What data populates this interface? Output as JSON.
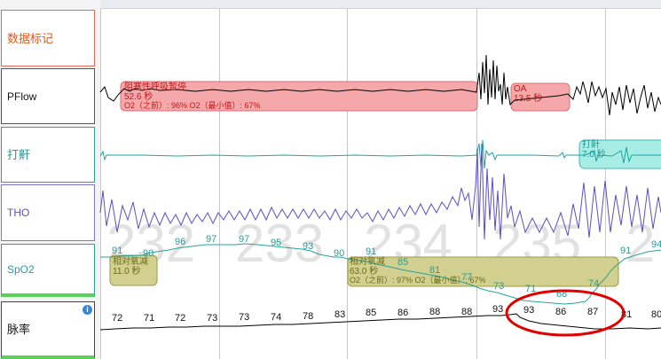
{
  "labels": {
    "marker": "数据标记",
    "pflow": "PFlow",
    "snore": "打鼾",
    "tho": "THO",
    "spo2": "SpO2",
    "pulse": "脉率"
  },
  "epochs": {
    "e1": "232",
    "e2": "233",
    "e3": "234",
    "e4": "235",
    "e5": "2"
  },
  "events": {
    "obstructive_apnea": {
      "title": "阻塞性呼吸暂停",
      "duration": "52.6 秒",
      "details": "O2（之前）: 96%  O2（最小值）: 67%"
    },
    "oa": {
      "title": "OA",
      "duration": "13.5 秒"
    },
    "snore": {
      "title": "打鼾",
      "duration": "7.0 秒"
    },
    "hypopnea1": {
      "title": "相对氧减",
      "duration": "11.0 秒"
    },
    "hypopnea2": {
      "title": "相对氧减",
      "duration": "63.0 秒",
      "details": "O2（之前）: 97%  O2（最小值）: 67%"
    }
  },
  "spo2_values": {
    "v1": "91",
    "v2": "90",
    "v3": "96",
    "v4": "97",
    "v5": "97",
    "v6": "95",
    "v7": "93",
    "v8": "90",
    "v9": "91",
    "v10": "85",
    "v11": "81",
    "v12": "77",
    "v13": "73",
    "v14": "71",
    "v15": "68",
    "v16": "74",
    "v17": "91",
    "v18": "94"
  },
  "pulse_values": {
    "p1": "72",
    "p2": "71",
    "p3": "72",
    "p4": "73",
    "p5": "73",
    "p6": "74",
    "p7": "78",
    "p8": "83",
    "p9": "85",
    "p10": "86",
    "p11": "88",
    "p12": "88",
    "p13": "93",
    "p14": "93",
    "p15": "86",
    "p16": "87",
    "p17": "81",
    "p18": "80"
  },
  "colors": {
    "apnea_box": "#f5a8aa",
    "snore_box": "#a8ece6",
    "hypopnea_box": "#d2d08e",
    "pflow_line": "#000000",
    "snore_line": "#1aa6a0",
    "tho_line": "#5a4fc8",
    "spo2_line": "#2aa19a",
    "pulse_line": "#000000",
    "highlight_circle": "#e00000"
  }
}
